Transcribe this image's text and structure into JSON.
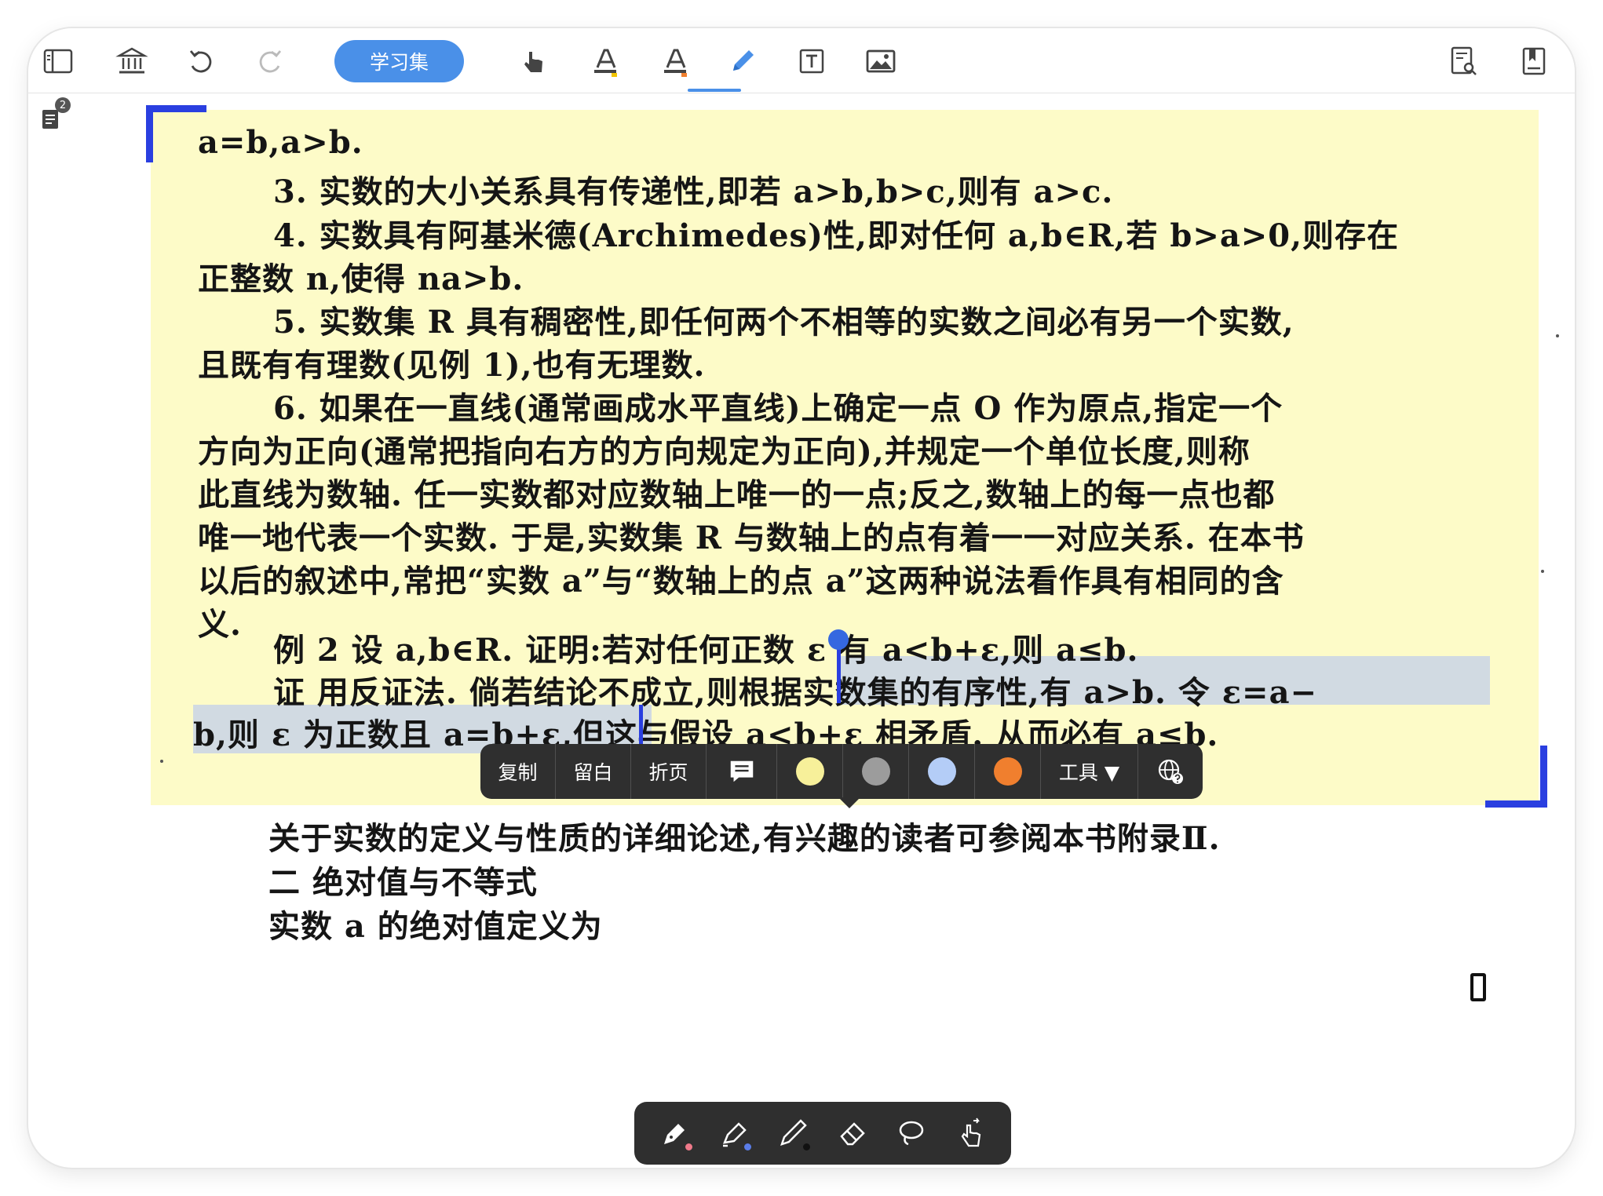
{
  "toolbar": {
    "study_set_label": "学习集"
  },
  "notes_badge": "2",
  "content": {
    "lines_highlighted": [
      "a=b,a>b.",
      "3. 实数的大小关系具有传递性,即若 a>b,b>c,则有 a>c.",
      "4. 实数具有阿基米德(Archimedes)性,即对任何 a,b∈R,若 b>a>0,则存在",
      "正整数 n,使得 na>b.",
      "5. 实数集 R 具有稠密性,即任何两个不相等的实数之间必有另一个实数,",
      "且既有有理数(见例 1),也有无理数.",
      "6. 如果在一直线(通常画成水平直线)上确定一点 O 作为原点,指定一个",
      "方向为正向(通常把指向右方的方向规定为正向),并规定一个单位长度,则称",
      "此直线为数轴. 任一实数都对应数轴上唯一的一点;反之,数轴上的每一点也都",
      "唯一地代表一个实数. 于是,实数集 R 与数轴上的点有着一一对应关系. 在本书",
      "以后的叙述中,常把“实数 a”与“数轴上的点 a”这两种说法看作具有相同的含",
      "义."
    ],
    "example_line": "例 2   设 a,b∈R. 证明:若对任何正数 ε 有 a<b+ε,则 a≤b.",
    "proof_line_1": "证   用反证法. 倘若结论不成立,则根据实数集的有序性,有 a>b. 令 ε=a−",
    "proof_line_2": "b,则 ε 为正数且 a=b+ε,但这与假设 a<b+ε 相矛盾. 从而必有 a≤b.",
    "appendix_line": "关于实数的定义与性质的详细论述,有兴趣的读者可参阅本书附录Ⅱ.",
    "section_heading": "二   绝对值与不等式",
    "cutoff_line": "实数 a 的绝对值定义为"
  },
  "context_menu": {
    "copy": "复制",
    "leave_blank": "留白",
    "fold_page": "折页",
    "tools": "工具 ▼"
  },
  "colors": {
    "swatch_yellow": "#f7f09a",
    "swatch_gray": "#9c9c9c",
    "swatch_blue": "#b4cdf7",
    "swatch_orange": "#f07f2e",
    "accent": "#4a90e8",
    "highlight": "#fdfbc8",
    "selection_bracket": "#2a3fe0"
  }
}
